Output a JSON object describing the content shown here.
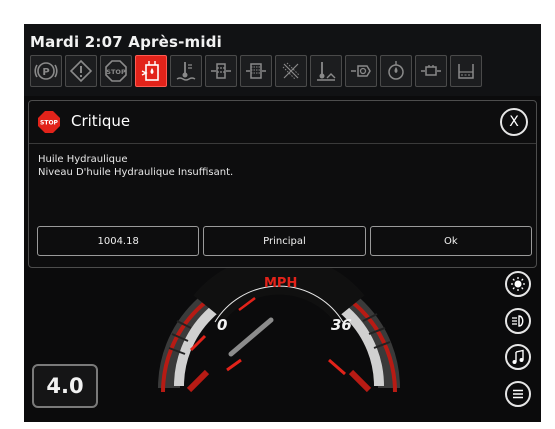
{
  "status": {
    "clock": "Mardi 2:07 Après-midi"
  },
  "warning_icons": [
    "parking-brake-icon",
    "general-warning-icon",
    "stop-icon",
    "hydraulic-oil-level-icon",
    "coolant-temp-icon",
    "fuel-filter-icon",
    "hydraulic-filter-icon",
    "air-filter-icon",
    "engine-oil-temp-icon",
    "transmission-icon",
    "oil-pressure-icon",
    "battery-icon",
    "washer-fluid-icon"
  ],
  "dialog": {
    "severity_icon": "stop-sign-icon",
    "stop_text": "STOP",
    "title": "Critique",
    "close_label": "X",
    "line1": "Huile Hydraulique",
    "line2": "Niveau D'huile Hydraulique Insuffisant.",
    "buttons": {
      "code": "1004.18",
      "principal": "Principal",
      "ok": "Ok"
    }
  },
  "gauge": {
    "unit": "MPH",
    "min_label": "0",
    "max_label": "36"
  },
  "side_buttons": [
    "brightness-icon",
    "headlight-icon",
    "music-icon",
    "menu-icon"
  ],
  "gear": {
    "value": "4.0"
  },
  "colors": {
    "accent_red": "#e2231a",
    "background": "#0b0b0c"
  }
}
